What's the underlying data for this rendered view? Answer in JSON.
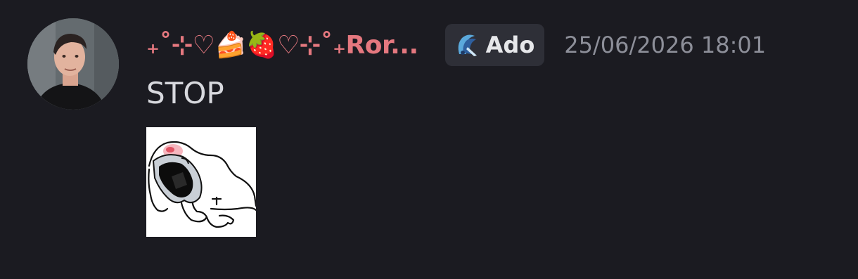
{
  "message": {
    "author": {
      "display_name": "₊˚⊹♡🍰🍓♡⊹˚₊Ror...",
      "name_color": "#e5787f",
      "avatar_icon": "user-avatar"
    },
    "role_tag": {
      "icon": "ado-emblem-icon",
      "label": "Ado"
    },
    "timestamp": "25/06/2026 18:01",
    "text": "STOP",
    "attachment": {
      "type": "image",
      "icon": "screaming-doodle-image"
    }
  },
  "colors": {
    "background": "#1b1b21",
    "text": "#d8d9de",
    "muted": "#8d8f99",
    "tag_background": "#2e2f37"
  }
}
